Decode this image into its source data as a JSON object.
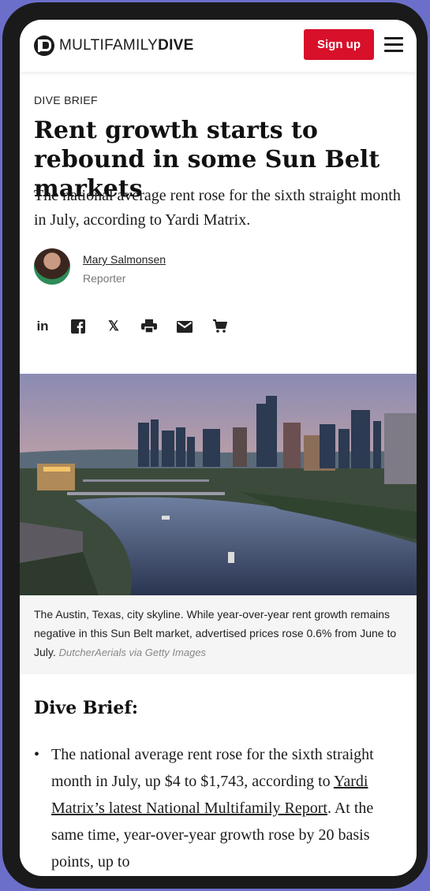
{
  "header": {
    "brand_light": "MULTIFAMILY",
    "brand_bold": "DIVE",
    "signup_label": "Sign up",
    "accent": "#d8102a"
  },
  "article": {
    "kicker": "DIVE BRIEF",
    "headline": "Rent growth starts to rebound in some Sun Belt markets",
    "dek": "The national average rent rose for the sixth straight month in July, according to Yardi Matrix.",
    "author": {
      "name": "Mary Salmonsen",
      "role": "Reporter"
    },
    "share_icons": [
      "linkedin-icon",
      "facebook-icon",
      "x-icon",
      "print-icon",
      "email-icon",
      "cart-icon"
    ],
    "share_linkedin_label": "in",
    "share_x_label": "𝕏",
    "image_caption": "The Austin, Texas, city skyline. While year-over-year rent growth remains negative in this Sun Belt market, advertised prices rose 0.6% from June to July.",
    "image_credit": "DutcherAerials via Getty Images",
    "section_title": "Dive Brief:",
    "bullet_1_part1": "The national average rent rose for the sixth straight month in July, up $4 to $1,743, according to ",
    "bullet_1_link": "Yardi Matrix’s latest National Multifamily Report",
    "bullet_1_part2": ". At the same time, year-over-year growth rose by 20 basis points, up to"
  }
}
